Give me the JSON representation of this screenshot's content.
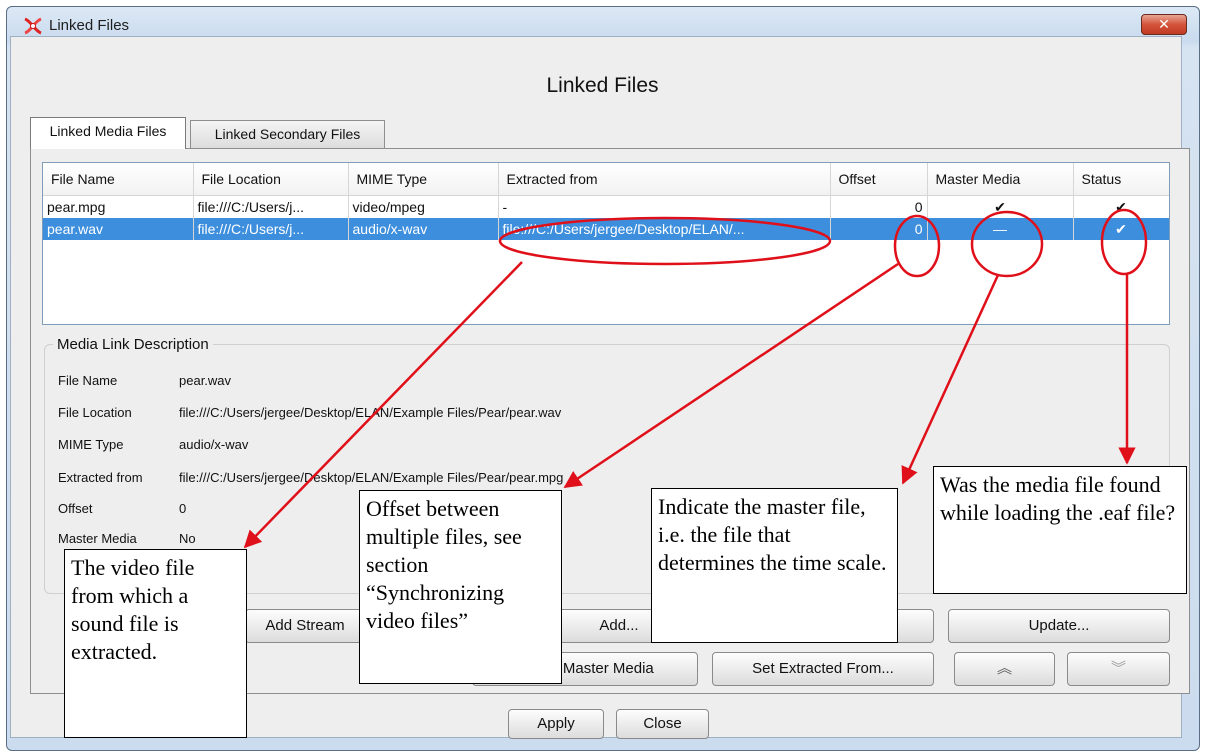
{
  "window": {
    "title": "Linked Files",
    "close_glyph": "✕",
    "app_icon": "elan-logo-icon"
  },
  "dialog": {
    "heading": "Linked Files"
  },
  "tabs": [
    {
      "label": "Linked Media Files",
      "active": true
    },
    {
      "label": "Linked Secondary Files",
      "active": false
    }
  ],
  "table": {
    "columns": [
      "File Name",
      "File Location",
      "MIME Type",
      "Extracted from",
      "Offset",
      "Master Media",
      "Status"
    ],
    "rows": [
      {
        "file_name": "pear.mpg",
        "file_location": "file:///C:/Users/j...",
        "mime_type": "video/mpeg",
        "extracted_from": "-",
        "offset": "0",
        "master_media": "✔",
        "status": "✔",
        "selected": false
      },
      {
        "file_name": "pear.wav",
        "file_location": "file:///C:/Users/j...",
        "mime_type": "audio/x-wav",
        "extracted_from": "file:///C:/Users/jergee/Desktop/ELAN/...",
        "offset": "0",
        "master_media": "—",
        "status": "✔",
        "selected": true
      }
    ]
  },
  "description": {
    "legend": "Media Link Description",
    "fields": [
      {
        "label": "File Name",
        "value": "pear.wav"
      },
      {
        "label": "File Location",
        "value": "file:///C:/Users/jergee/Desktop/ELAN/Example Files/Pear/pear.wav"
      },
      {
        "label": "MIME Type",
        "value": "audio/x-wav"
      },
      {
        "label": "Extracted from",
        "value": "file:///C:/Users/jergee/Desktop/ELAN/Example Files/Pear/pear.mpg"
      },
      {
        "label": "Offset",
        "value": "0"
      },
      {
        "label": "Master Media",
        "value": "No"
      }
    ]
  },
  "buttons": {
    "add_stream": "Add Stream",
    "add": "Add...",
    "update": "Update...",
    "set_master_media": "Set as Master Media",
    "set_extracted_from": "Set Extracted From...",
    "move_up": "︽",
    "move_down": "︾",
    "apply": "Apply",
    "close": "Close"
  },
  "callouts": {
    "video_file": "The video file from which a sound file is extracted.",
    "offset": "Offset between multiple files, see section “Synchronizing video files”",
    "master": "Indicate the master file, i.e. the file that determines the time scale.",
    "status": "Was the media file found while loading the .eaf file?"
  },
  "colors": {
    "selection": "#3d8fdd",
    "annotation": "#e0101a",
    "close_button": "#c9452c"
  }
}
